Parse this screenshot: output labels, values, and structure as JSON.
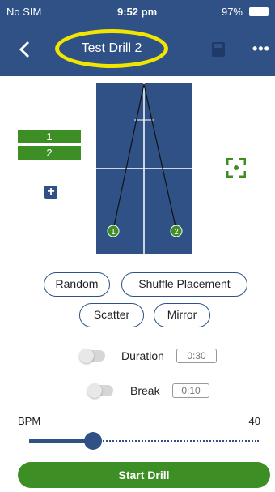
{
  "status_bar": {
    "carrier": "No SIM",
    "time": "9:52 pm",
    "battery": "97%"
  },
  "nav": {
    "title": "Test Drill 2"
  },
  "players": [
    {
      "label": "1"
    },
    {
      "label": "2"
    }
  ],
  "court_markers": [
    {
      "label": "1"
    },
    {
      "label": "2"
    }
  ],
  "placement_buttons": {
    "random": "Random",
    "shuffle": "Shuffle Placement",
    "scatter": "Scatter",
    "mirror": "Mirror"
  },
  "duration": {
    "label": "Duration",
    "value": "0:30"
  },
  "break": {
    "label": "Break",
    "value": "0:10"
  },
  "bpm": {
    "label": "BPM",
    "value": "40"
  },
  "start_button": {
    "label": "Start Drill"
  },
  "colors": {
    "primary": "#2f5186",
    "accent_green": "#3e8e26",
    "highlight_yellow": "#f2e600"
  }
}
